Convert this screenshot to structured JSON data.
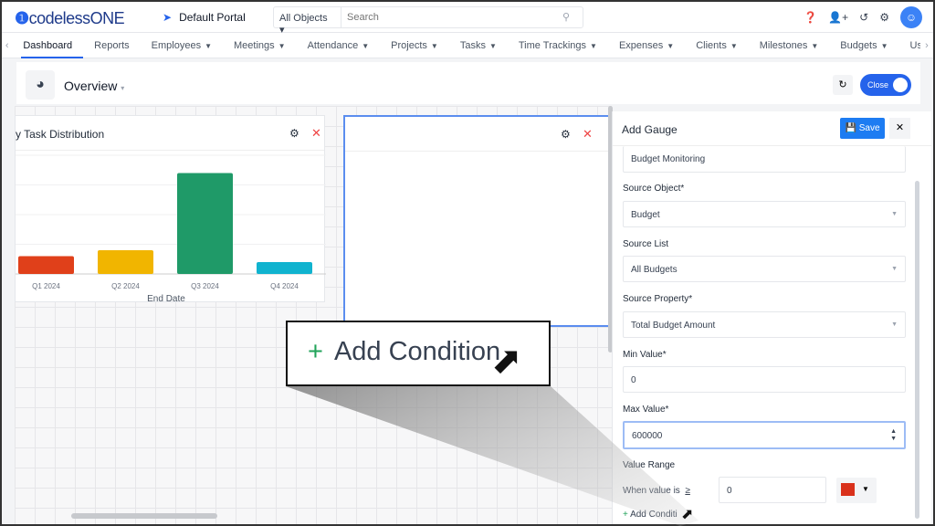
{
  "header": {
    "logo": "codelessONE",
    "portal": "Default Portal",
    "search_scope": "All Objects",
    "search_placeholder": "Search",
    "icons": [
      "help-icon",
      "add-user-icon",
      "history-icon",
      "gear-icon",
      "avatar-icon"
    ]
  },
  "nav": {
    "items": [
      {
        "label": "Dashboard",
        "active": true
      },
      {
        "label": "Reports"
      },
      {
        "label": "Employees",
        "dropdown": true
      },
      {
        "label": "Meetings",
        "dropdown": true
      },
      {
        "label": "Attendance",
        "dropdown": true
      },
      {
        "label": "Projects",
        "dropdown": true
      },
      {
        "label": "Tasks",
        "dropdown": true
      },
      {
        "label": "Time Trackings",
        "dropdown": true
      },
      {
        "label": "Expenses",
        "dropdown": true
      },
      {
        "label": "Clients",
        "dropdown": true
      },
      {
        "label": "Milestones",
        "dropdown": true
      },
      {
        "label": "Budgets",
        "dropdown": true
      },
      {
        "label": "Us"
      }
    ]
  },
  "overview": {
    "title": "Overview",
    "close_label": "Close"
  },
  "widget1": {
    "title": "y Task Distribution"
  },
  "chart_data": {
    "type": "bar",
    "categories": [
      "Q1 2024",
      "Q2 2024",
      "Q3 2024",
      "Q4 2024"
    ],
    "values": [
      0.6,
      0.8,
      3.4,
      0.4
    ],
    "xlabel": "End Date",
    "ylabel": "",
    "grid": true,
    "colors": [
      "#e0401a",
      "#f1b500",
      "#1f9a68",
      "#10b3cf"
    ]
  },
  "panel": {
    "title": "Add Gauge",
    "save_label": "Save",
    "name_value": "Budget Monitoring",
    "source_object_label": "Source Object*",
    "source_object": "Budget",
    "source_list_label": "Source List",
    "source_list": "All Budgets",
    "source_property_label": "Source Property*",
    "source_property": "Total Budget Amount",
    "min_label": "Min Value*",
    "min_value": "0",
    "max_label": "Max Value*",
    "max_value": "600000",
    "range_label": "Value Range",
    "when_label": "When value is",
    "operator": "≥",
    "range_value": "0",
    "range_color": "#d9311b",
    "add_condition": "Add Conditi"
  },
  "callout": {
    "text": "Add Condition"
  }
}
